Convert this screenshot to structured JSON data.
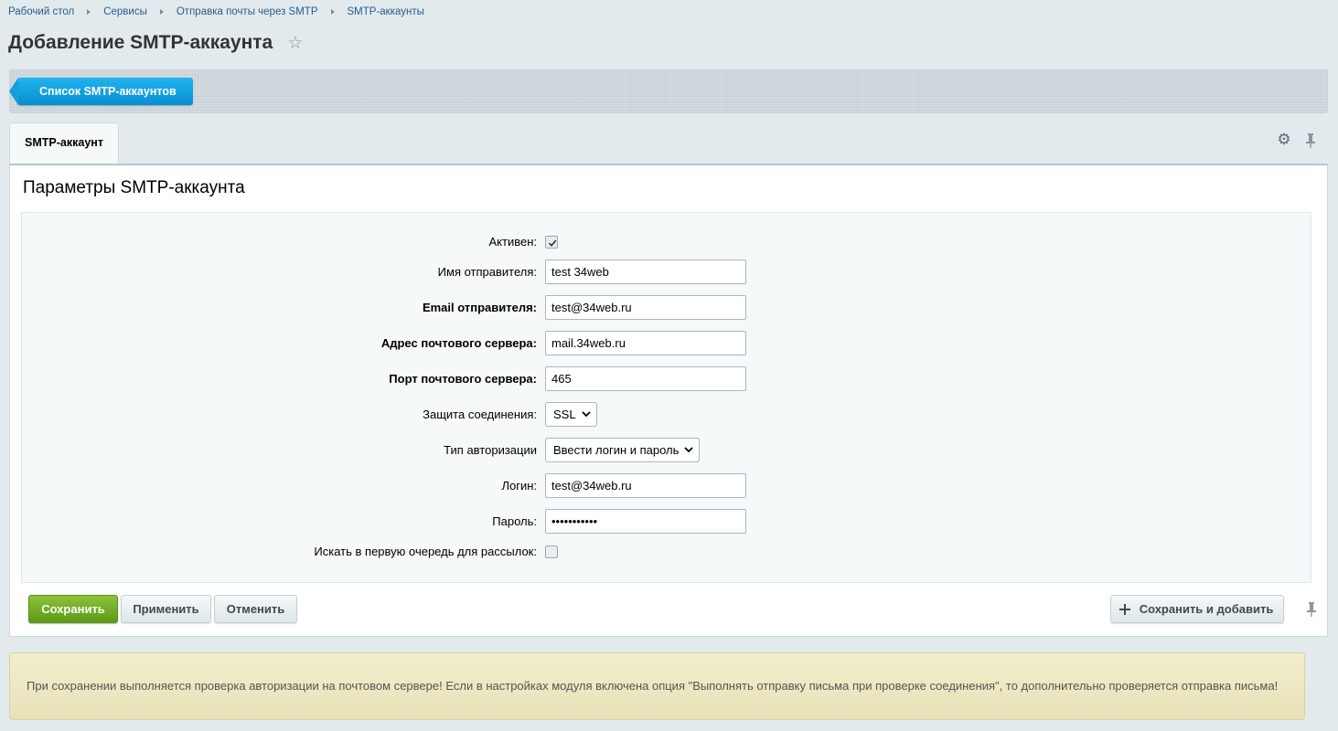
{
  "breadcrumb": [
    "Рабочий стол",
    "Сервисы",
    "Отправка почты через SMTP",
    "SMTP-аккаунты"
  ],
  "page": {
    "title": "Добавление SMTP-аккаунта"
  },
  "toolbar": {
    "list_button": "Список SMTP-аккаунтов"
  },
  "tabs": [
    {
      "label": "SMTP-аккаунт",
      "active": true
    }
  ],
  "section": {
    "title": "Параметры SMTP-аккаунта"
  },
  "form": {
    "active": {
      "label": "Активен:",
      "checked": true
    },
    "sender_name": {
      "label": "Имя отправителя:",
      "value": "test 34web"
    },
    "sender_email": {
      "label": "Email отправителя:",
      "value": "test@34web.ru"
    },
    "server_address": {
      "label": "Адрес почтового сервера:",
      "value": "mail.34web.ru"
    },
    "server_port": {
      "label": "Порт почтового сервера:",
      "value": "465"
    },
    "security": {
      "label": "Защита соединения:",
      "value": "SSL"
    },
    "auth_type": {
      "label": "Тип авторизации",
      "value": "Ввести логин и пароль"
    },
    "login": {
      "label": "Логин:",
      "value": "test@34web.ru"
    },
    "password": {
      "label": "Пароль:",
      "value": "•••••••••••"
    },
    "priority": {
      "label": "Искать в первую очередь для рассылок:",
      "checked": false
    }
  },
  "buttons": {
    "save": "Сохранить",
    "apply": "Применить",
    "cancel": "Отменить",
    "save_and_add": "Сохранить и добавить"
  },
  "notice": "При сохранении выполняется проверка авторизации на почтовом сервере! Если в настройках модуля включена опция \"Выполнять отправку письма при проверке соединения\", то дополнительно проверяется отправка письма!",
  "colors": {
    "accent_blue": "#078ed0",
    "save_green": "#5b9a16",
    "background": "#e2eaee",
    "notice_bg": "#f3efcd"
  },
  "icons": [
    "star-icon",
    "gear-icon",
    "pin-icon",
    "check-icon",
    "chevron-down-icon",
    "plus-icon"
  ]
}
